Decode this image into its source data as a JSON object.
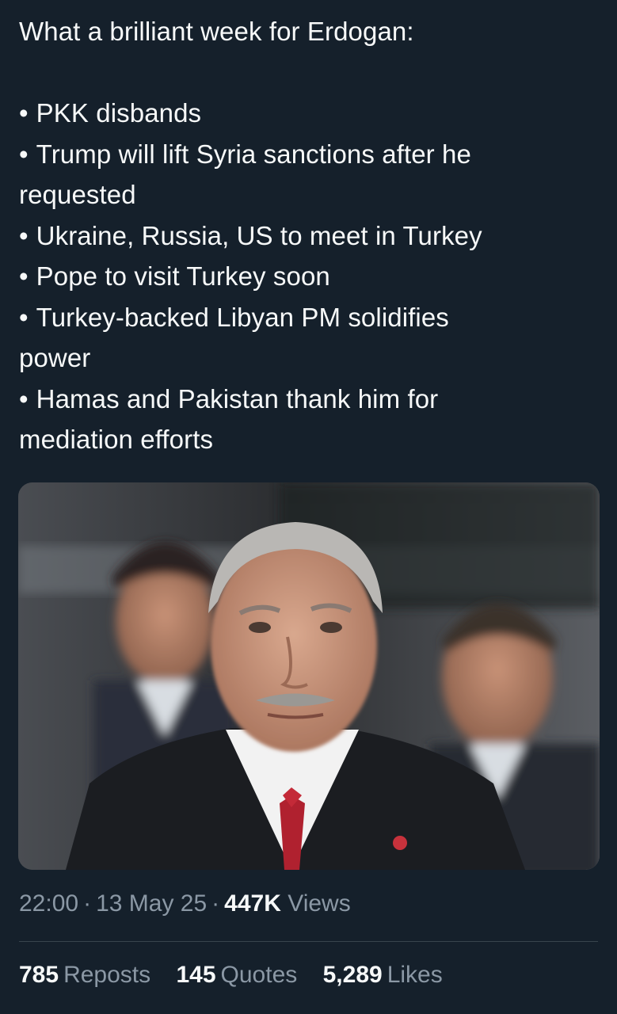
{
  "tweet": {
    "intro": "What a brilliant week for Erdogan:",
    "bullet_char": "•",
    "bullets": [
      [
        "PKK disbands"
      ],
      [
        "Trump will lift Syria sanctions after he",
        "requested"
      ],
      [
        "Ukraine, Russia, US to meet in Turkey"
      ],
      [
        "Pope to visit Turkey soon"
      ],
      [
        "Turkey-backed Libyan PM solidifies",
        "power"
      ],
      [
        "Hamas and Pakistan thank him for",
        "mediation efforts"
      ]
    ]
  },
  "meta": {
    "time": "22:00",
    "separator": "·",
    "date": "13 May 25",
    "views_count": "447K",
    "views_label": "Views"
  },
  "stats": {
    "reposts_count": "785",
    "reposts_label": "Reposts",
    "quotes_count": "145",
    "quotes_label": "Quotes",
    "likes_count": "5,289",
    "likes_label": "Likes"
  },
  "colors": {
    "background": "#15202b",
    "text": "#f7f9f9",
    "secondary_text": "#8b98a5",
    "divider": "#38444d"
  }
}
